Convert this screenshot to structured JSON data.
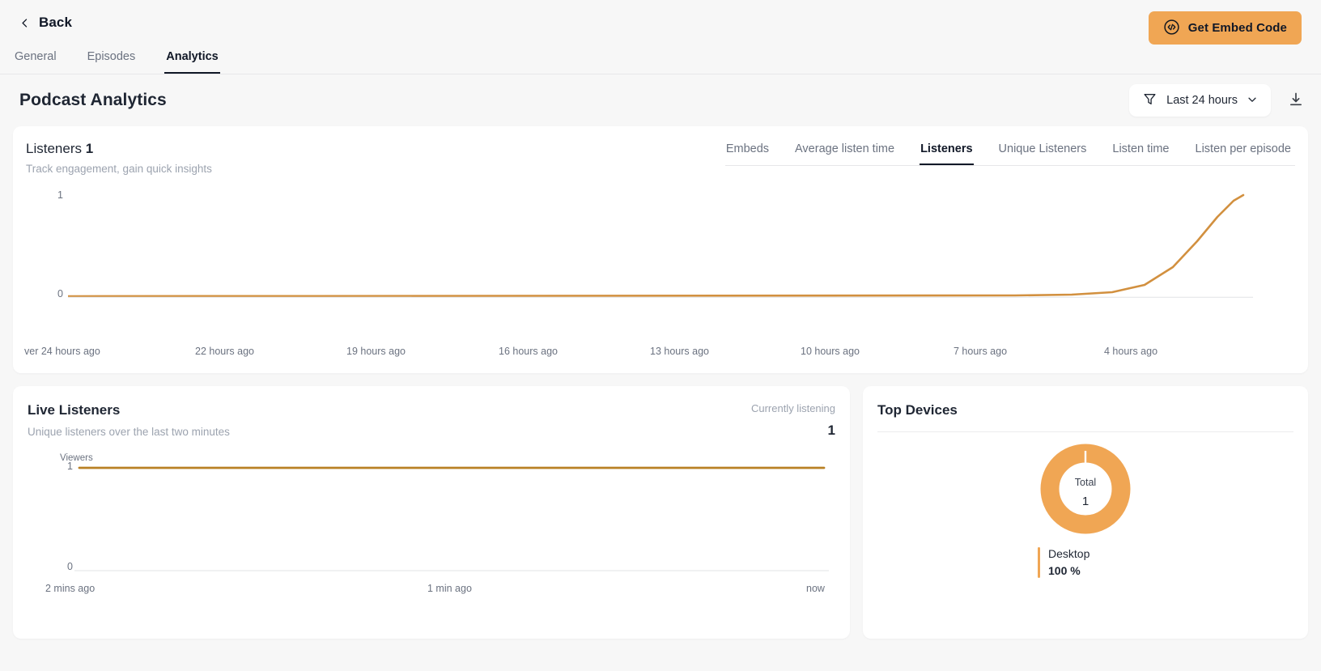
{
  "topbar": {
    "back_label": "Back",
    "embed_button_label": "Get Embed Code"
  },
  "nav_tabs": [
    {
      "label": "General",
      "active": false
    },
    {
      "label": "Episodes",
      "active": false
    },
    {
      "label": "Analytics",
      "active": true
    }
  ],
  "page": {
    "title": "Podcast Analytics",
    "range_label": "Last 24 hours"
  },
  "listeners_card": {
    "title_text": "Listeners",
    "title_value": "1",
    "subtitle": "Track engagement, gain quick insights",
    "metric_tabs": [
      {
        "label": "Embeds",
        "active": false
      },
      {
        "label": "Average listen time",
        "active": false
      },
      {
        "label": "Listeners",
        "active": true
      },
      {
        "label": "Unique Listeners",
        "active": false
      },
      {
        "label": "Listen time",
        "active": false
      },
      {
        "label": "Listen per episode",
        "active": false
      }
    ]
  },
  "live_listeners": {
    "title": "Live Listeners",
    "subtitle": "Unique listeners over the last two minutes",
    "currently_listening_label": "Currently listening",
    "currently_listening_value": "1",
    "series_label": "Viewers"
  },
  "top_devices": {
    "title": "Top Devices",
    "center_label": "Total",
    "center_value": "1",
    "legend": [
      {
        "name": "Desktop",
        "percent": "100 %"
      }
    ]
  },
  "colors": {
    "accent": "#f0a654",
    "line": "#d2903f",
    "text": "#1f2633",
    "muted": "#9ca3af"
  },
  "chart_data": [
    {
      "type": "line",
      "title": "Listeners",
      "xlabel": "",
      "ylabel": "",
      "ylim": [
        0,
        1
      ],
      "yticks": [
        "0",
        "1"
      ],
      "xticks": [
        "ver 24 hours ago",
        "22 hours ago",
        "19 hours ago",
        "16 hours ago",
        "13 hours ago",
        "10 hours ago",
        "7 hours ago",
        "4 hours ago"
      ],
      "grid": false,
      "legend": "none",
      "series": [
        {
          "name": "Listeners",
          "color": "#d2903f",
          "x": [
            0,
            10,
            20,
            30,
            40,
            50,
            60,
            70,
            80,
            85,
            88,
            91,
            93,
            95,
            97,
            98,
            99,
            100
          ],
          "values": [
            0,
            0,
            0,
            0,
            0,
            0,
            0,
            0,
            0,
            0,
            0.02,
            0.06,
            0.16,
            0.34,
            0.6,
            0.8,
            0.93,
            1
          ]
        }
      ]
    },
    {
      "type": "line",
      "title": "Live Listeners",
      "xlabel": "",
      "ylabel": "Viewers",
      "ylim": [
        0,
        1
      ],
      "yticks": [
        "0",
        "1"
      ],
      "xticks": [
        "2 mins ago",
        "1 min ago",
        "now"
      ],
      "grid": false,
      "legend": "none",
      "series": [
        {
          "name": "Viewers",
          "color": "#b98024",
          "x": [
            0,
            25,
            50,
            75,
            97
          ],
          "values": [
            1,
            1,
            1,
            1,
            1
          ]
        }
      ]
    },
    {
      "type": "pie",
      "title": "Top Devices",
      "donut": true,
      "center_label": "Total",
      "center_value": 1,
      "labels": [
        "Desktop"
      ],
      "values": [
        100
      ],
      "colors": [
        "#f0a654"
      ],
      "legend": "bottom-left"
    }
  ]
}
